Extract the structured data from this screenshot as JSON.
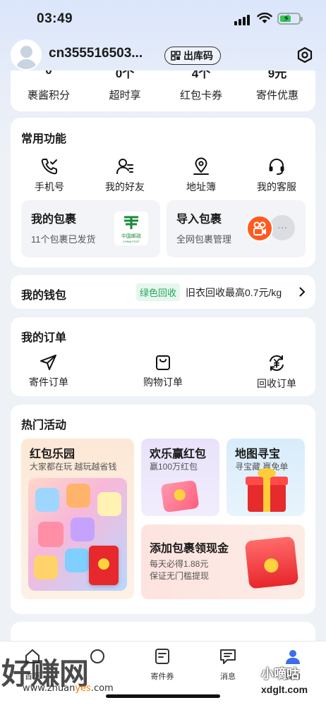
{
  "status_bar": {
    "time": "03:49"
  },
  "header": {
    "username": "cn355516503...",
    "outbound_code_label": "出库码",
    "avatar_icon": "user-avatar-icon",
    "settings_icon": "hexagon-settings-icon"
  },
  "stats": [
    {
      "value": "0",
      "label": "裹酱积分"
    },
    {
      "value": "0个",
      "label": "超时享"
    },
    {
      "value": "4个",
      "label": "红包卡券"
    },
    {
      "value": "9元",
      "label": "寄件优惠"
    }
  ],
  "common_functions": {
    "title": "常用功能",
    "items": [
      {
        "label": "手机号",
        "icon": "phone-check-icon"
      },
      {
        "label": "我的好友",
        "icon": "friends-icon"
      },
      {
        "label": "地址簿",
        "icon": "location-pin-icon"
      },
      {
        "label": "我的客服",
        "icon": "headset-icon"
      }
    ],
    "my_packages": {
      "title": "我的包裹",
      "subtitle": "11个包裹已发货",
      "logo_text_cn": "中国邮政",
      "logo_text_en": "CHINA POST"
    },
    "import_packages": {
      "title": "导入包裹",
      "subtitle": "全网包裹管理",
      "more": "···"
    }
  },
  "wallet": {
    "title": "我的钱包",
    "tag": "绿色回收",
    "text": "旧衣回收最高0.7元/kg"
  },
  "orders": {
    "title": "我的订单",
    "items": [
      {
        "label": "寄件订单",
        "icon": "send-plane-icon"
      },
      {
        "label": "购物订单",
        "icon": "shopping-bag-icon"
      },
      {
        "label": "回收订单",
        "icon": "recycle-yuan-icon"
      }
    ]
  },
  "hot_activities": {
    "title": "热门活动",
    "cards": [
      {
        "title": "红包乐园",
        "subtitle": "大家都在玩 越玩越省钱",
        "bg": "#fdeedd"
      },
      {
        "title": "欢乐赢红包",
        "subtitle": "赢100万红包",
        "bg": "#ece6fb"
      },
      {
        "title": "地图寻宝",
        "subtitle": "寻宝藏 赢免单",
        "bg": "#e0f0fb"
      },
      {
        "title": "添加包裹领现金",
        "subtitle": "每天必得1.88元",
        "subtitle2": "保证无门槛提现",
        "bg": "#fde6e3"
      }
    ]
  },
  "tabbar": {
    "items": [
      {
        "label": "首页",
        "icon": "home-icon"
      },
      {
        "label": "",
        "icon": "box-icon"
      },
      {
        "label": "寄件券",
        "icon": "coupon-icon"
      },
      {
        "label": "消息",
        "icon": "message-icon"
      },
      {
        "label": "我的",
        "icon": "profile-icon"
      }
    ]
  },
  "watermarks": {
    "main": "好赚网",
    "url_prefix": "www.zhuan",
    "url_mid": "yes",
    "url_suffix": ".com",
    "right_big": "小嘀咕",
    "right_url": "xdglt.com"
  },
  "colors": {
    "accent_orange": "#ff6a13",
    "accent_green": "#25a55f",
    "brand_blue": "#3b6fe8"
  }
}
